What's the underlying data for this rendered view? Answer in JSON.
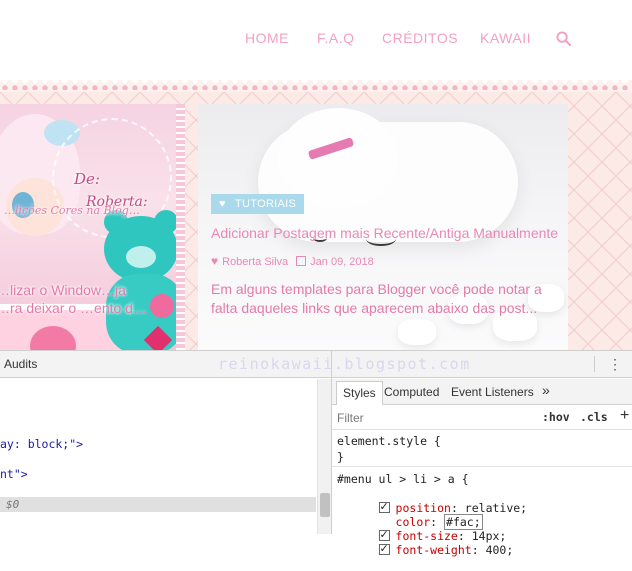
{
  "nav": {
    "items": [
      {
        "label": "HOME"
      },
      {
        "label": "F.A.Q"
      },
      {
        "label": "CRÉDITOS"
      },
      {
        "label": "KAWAII"
      }
    ],
    "search_icon": "search-icon"
  },
  "left_post": {
    "line1": "De:",
    "line2": "Roberta:",
    "line3": "…lições Cores na Blog…",
    "line4": "…lizar o Window…ja",
    "line5": "…ra deixar o …ento d…"
  },
  "post": {
    "category": "TUTORIAIS",
    "title": "Adicionar Postagem mais Recente/Antiga Manualmente",
    "author": "Roberta Silva",
    "date": "Jan 09, 2018",
    "excerpt": "Em alguns templates para Blogger você pode notar a falta daqueles links que aparecem abaixo das post..."
  },
  "watermark": "reinokawaii.blogspot.com",
  "devtools": {
    "left_tab": "Audits",
    "code_line1_tail": "ay: block;\">",
    "code_line2_tail": "nt\">",
    "selected_marker": "$0",
    "tabs": {
      "styles": "Styles",
      "computed": "Computed",
      "listeners": "Event Listeners",
      "more": "»"
    },
    "filter_placeholder": "Filter",
    "hov": ":hov",
    "cls": ".cls",
    "plus": "+",
    "element_style": "element.style {",
    "close_brace": "}",
    "rule_selector": "#menu ul > li > a {",
    "props": [
      {
        "name": "position",
        "value": "relative;",
        "checked": true
      },
      {
        "name": "color",
        "value": "#fac;",
        "checked": false,
        "editing": true
      },
      {
        "name": "font-size",
        "value": "14px;",
        "checked": true
      },
      {
        "name": "font-weight",
        "value": "400;",
        "checked": true
      }
    ]
  },
  "colors": {
    "nav_pink": "#f2a0c4",
    "badge_blue": "#a9d9ea",
    "post_pink": "#e889b6",
    "css_prop_red": "#c80000"
  }
}
